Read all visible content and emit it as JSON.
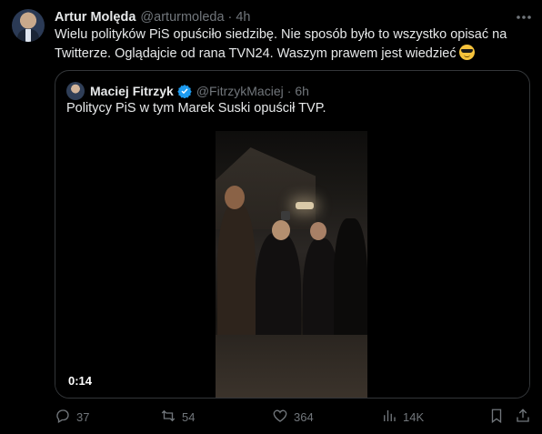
{
  "author": {
    "name": "Artur Molęda",
    "handle": "@arturmoleda",
    "separator": "·",
    "time": "4h"
  },
  "tweet_text": "Wielu polityków PiS opuściło siedzibę. Nie sposób było to wszystko opisać na Twitterze. Oglądajcie od rana TVN24. Waszym prawem jest wiedzieć",
  "quoted": {
    "name": "Maciej Fitrzyk",
    "handle": "@FitrzykMaciej",
    "separator": "·",
    "time": "6h",
    "text": "Politycy PiS w tym Marek Suski opuścił TVP.",
    "video_duration": "0:14"
  },
  "actions": {
    "replies": "37",
    "reposts": "54",
    "likes": "364",
    "views": "14K"
  },
  "colors": {
    "background": "#000000",
    "text": "#e7e9ea",
    "muted": "#71767b",
    "border": "#333639",
    "verified": "#1d9bf0"
  },
  "icons": [
    "more-icon",
    "verified-icon",
    "reply-icon",
    "repost-icon",
    "like-icon",
    "views-icon",
    "bookmark-icon",
    "share-icon",
    "emoji-sunglasses-icon"
  ]
}
